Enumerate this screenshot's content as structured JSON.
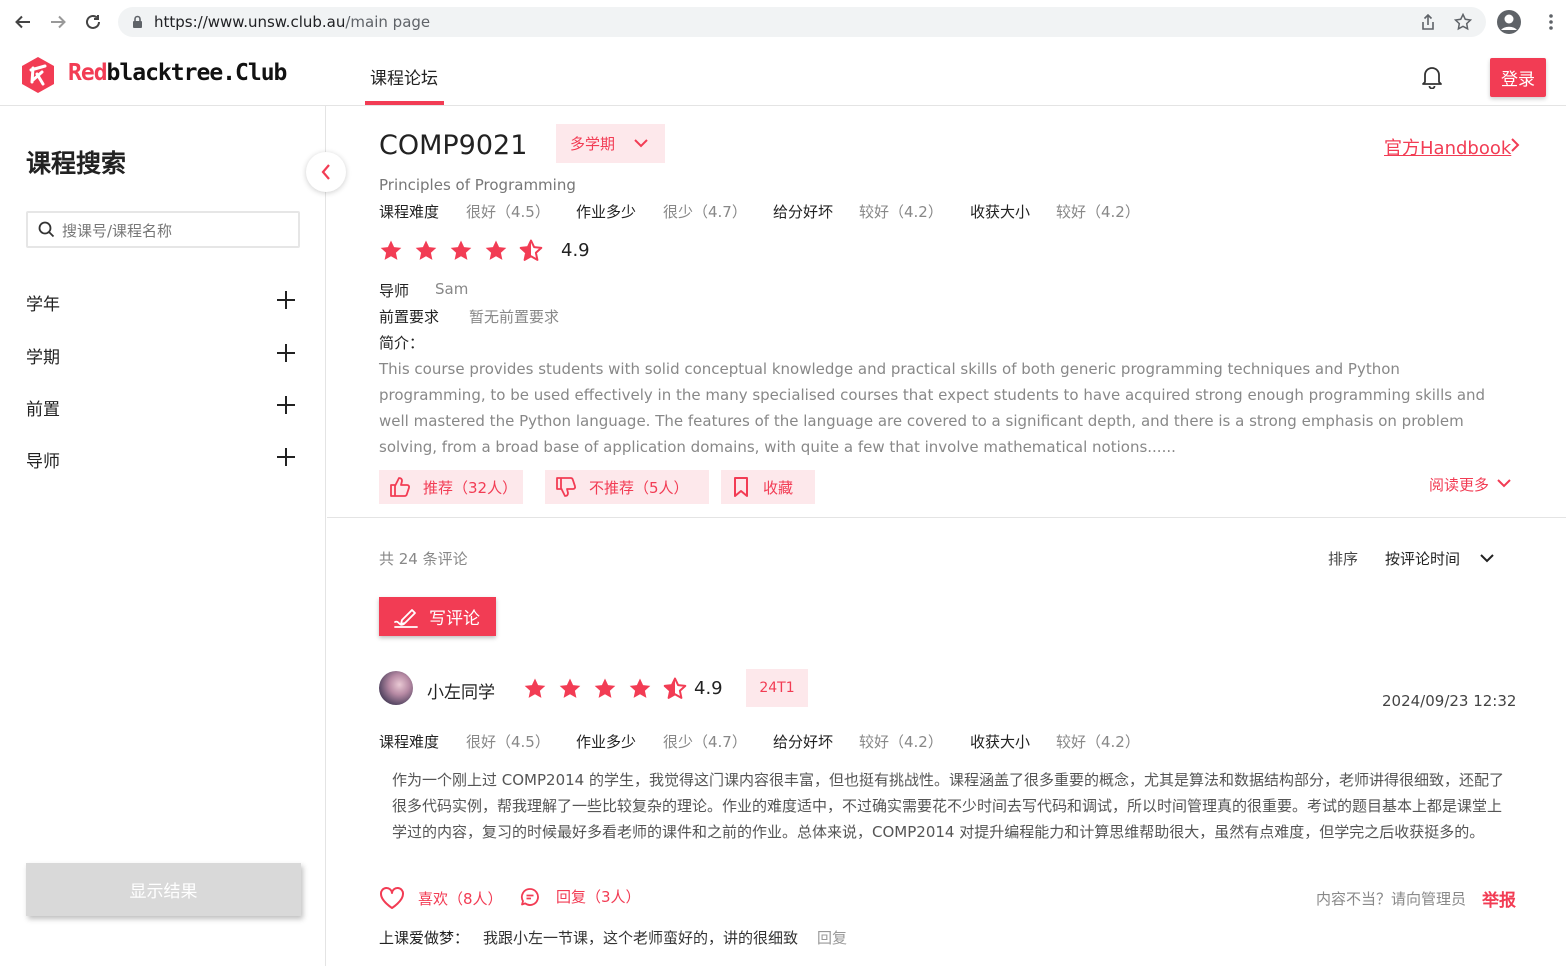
{
  "browser": {
    "url_host": "https://www.unsw.club.au",
    "url_path": "/main page"
  },
  "header": {
    "logo_red": "Red",
    "logo_black": "blacktree.Club",
    "nav_tab": "课程论坛",
    "login": "登录"
  },
  "sidebar": {
    "title": "课程搜索",
    "search_placeholder": "搜课号/课程名称",
    "filters": [
      "学年",
      "学期",
      "前置",
      "导师"
    ],
    "show_results": "显示结果"
  },
  "course": {
    "code": "COMP9021",
    "term_select": "多学期",
    "handbook": "官方Handbook",
    "name": "Principles of Programming",
    "metrics": [
      {
        "label": "课程难度",
        "value": "很好（4.5）"
      },
      {
        "label": "作业多少",
        "value": "很少（4.7）"
      },
      {
        "label": "给分好坏",
        "value": "较好（4.2）"
      },
      {
        "label": "收获大小",
        "value": "较好（4.2）"
      }
    ],
    "rating": 4.9,
    "rating_text": "4.9",
    "tutor_label": "导师",
    "tutor": "Sam",
    "prereq_label": "前置要求",
    "prereq": "暂无前置要求",
    "intro_label": "简介：",
    "intro": "This course provides students with solid conceptual knowledge and practical skills of both generic programming techniques and Python programming, to be used effectively in the many specialised courses that expect students to have acquired strong enough programming skills and well mastered the Python language. The features of the language are covered to a significant depth, and there is a strong emphasis on problem solving, from a broad base of application domains, with quite a few that involve mathematical notions......",
    "recommend": "推荐（32人）",
    "not_recommend": "不推荐（5人）",
    "favorite": "收藏",
    "read_more": "阅读更多"
  },
  "reviews": {
    "count_text": "共 24 条评论",
    "sort_label": "排序",
    "sort_value": "按评论时间",
    "write": "写评论",
    "items": [
      {
        "user": "小左同学",
        "rating": 4.9,
        "rating_text": "4.9",
        "term": "24T1",
        "time": "2024/09/23 12:32",
        "metrics": [
          {
            "label": "课程难度",
            "value": "很好（4.5）"
          },
          {
            "label": "作业多少",
            "value": "很少（4.7）"
          },
          {
            "label": "给分好坏",
            "value": "较好（4.2）"
          },
          {
            "label": "收获大小",
            "value": "较好（4.2）"
          }
        ],
        "body": "作为一个刚上过 COMP2014 的学生，我觉得这门课内容很丰富，但也挺有挑战性。课程涵盖了很多重要的概念，尤其是算法和数据结构部分，老师讲得很细致，还配了很多代码实例，帮我理解了一些比较复杂的理论。作业的难度适中，不过确实需要花不少时间去写代码和调试，所以时间管理真的很重要。考试的题目基本上都是课堂上学过的内容，复习的时候最好多看老师的课件和之前的作业。总体来说，COMP2014 对提升编程能力和计算思维帮助很大，虽然有点难度，但学完之后收获挺多的。",
        "likes": "喜欢（8人）",
        "replies": "回复（3人）",
        "report_hint": "内容不当？请向管理员",
        "report": "举报",
        "reply_user": "上课爱做梦：",
        "reply_text": "我跟小左一节课，这个老师蛮好的，讲的很细致",
        "reply_link": "回复"
      }
    ]
  },
  "colors": {
    "accent": "#f23c54",
    "accent_light": "#fde8eb",
    "disabled": "#d9d9d9"
  }
}
